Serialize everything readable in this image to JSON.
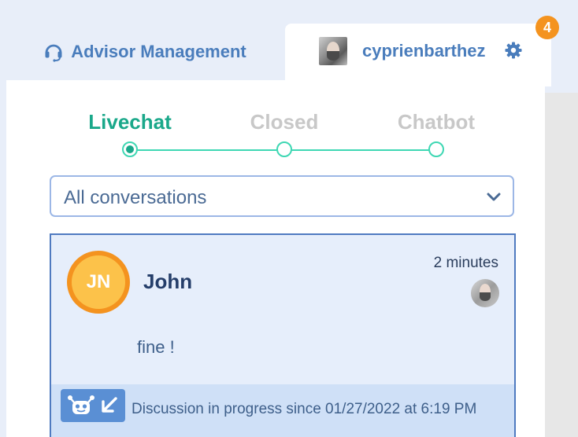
{
  "tabs": {
    "advisor_label": "Advisor Management",
    "user_label": "cyprienbarthez",
    "notification_count": "4"
  },
  "stepper": {
    "steps": [
      {
        "label": "Livechat",
        "active": true
      },
      {
        "label": "Closed",
        "active": false
      },
      {
        "label": "Chatbot",
        "active": false
      }
    ]
  },
  "filter": {
    "selected": "All conversations"
  },
  "conversation": {
    "initials": "JN",
    "name": "John",
    "time": "2 minutes",
    "message": "fine !",
    "status": "Discussion in progress since 01/27/2022 at 6:19 PM"
  },
  "colors": {
    "accent_blue": "#4a7dbc",
    "active_green": "#1aa88a",
    "step_line": "#3ed7b3",
    "badge_orange": "#f4931f",
    "avatar_yellow": "#fcc24a",
    "card_border": "#4f7ac0"
  },
  "icons": {
    "advisor_tab": "headset-icon",
    "settings": "gear-icon",
    "dropdown": "chevron-down-icon",
    "bot_status": "robot-icon",
    "transfer": "arrow-down-left-icon"
  }
}
